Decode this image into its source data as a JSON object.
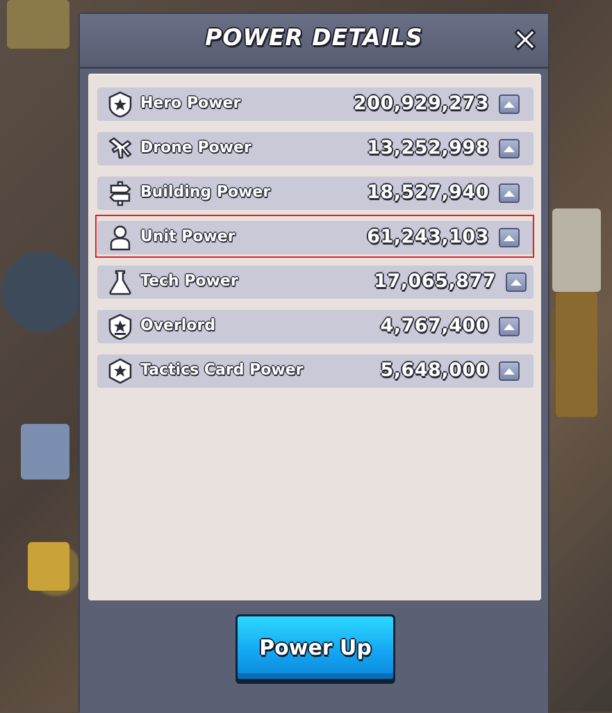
{
  "dialog": {
    "title": "POWER DETAILS",
    "close_icon": "close-x-icon"
  },
  "rows": [
    {
      "icon": "hero-shield-icon",
      "label": "Hero Power",
      "value": "200,929,273"
    },
    {
      "icon": "drone-icon",
      "label": "Drone Power",
      "value": "13,252,998"
    },
    {
      "icon": "building-signpost-icon",
      "label": "Building Power",
      "value": "18,527,940"
    },
    {
      "icon": "unit-person-icon",
      "label": "Unit Power",
      "value": "61,243,103"
    },
    {
      "icon": "tech-flask-icon",
      "label": "Tech Power",
      "value": "17,065,877"
    },
    {
      "icon": "overlord-shield-icon",
      "label": "Overlord",
      "value": "4,767,400"
    },
    {
      "icon": "tactics-card-icon",
      "label": "Tactics Card Power",
      "value": "5,648,000"
    }
  ],
  "footer": {
    "power_up_label": "Power Up"
  },
  "colors": {
    "highlight": "#e02020",
    "power_up": "#14a8f3",
    "row_bg": "#c9c9d8",
    "panel_bg": "#e9e1dd"
  }
}
